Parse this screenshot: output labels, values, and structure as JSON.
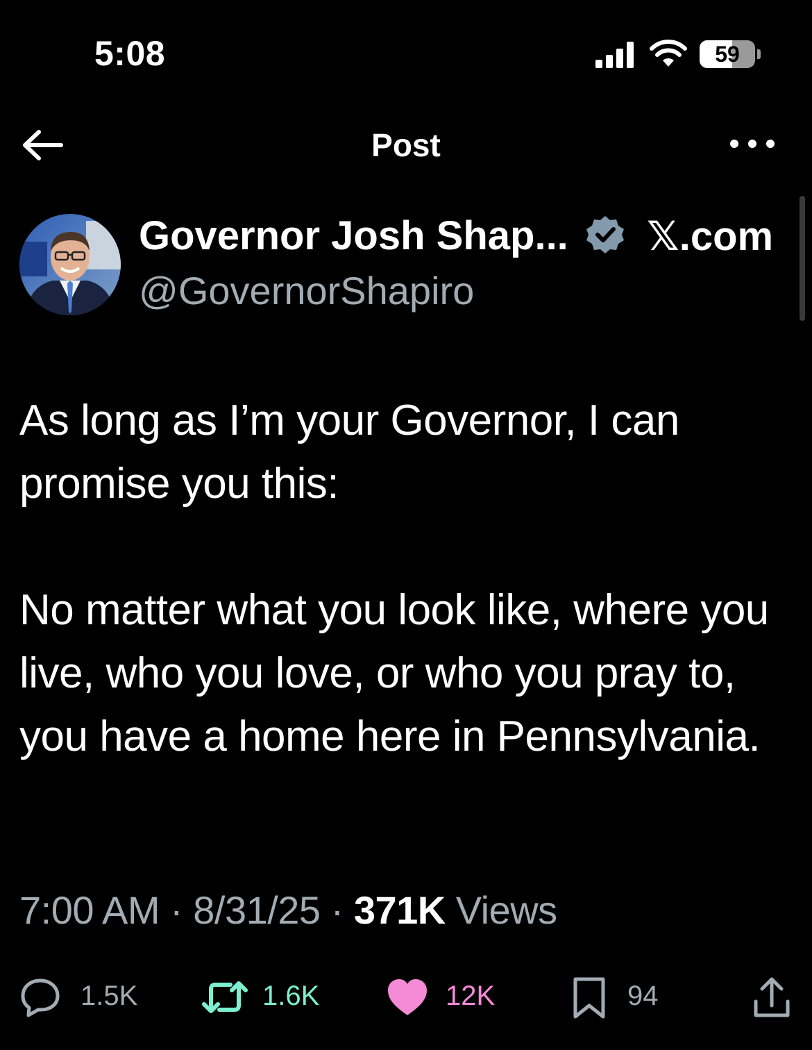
{
  "status_bar": {
    "time": "5:08",
    "battery": "59",
    "battery_level": 0.59
  },
  "nav": {
    "title": "Post"
  },
  "author": {
    "name": "Governor Josh Shap...",
    "handle": "@GovernorShapiro",
    "source_label": "𝕏.com"
  },
  "post": {
    "text": "As long as I’m your Governor, I can promise you this:\n\nNo matter what you look like, where you live, who you love, or who you pray to, you have a home here in Pennsylvania.",
    "time": "7:00 AM",
    "date": "8/31/25",
    "separator": " · ",
    "views_count": "371K",
    "views_label": " Views"
  },
  "actions": {
    "replies": "1.5K",
    "reposts": "1.6K",
    "likes": "12K",
    "bookmarks": "94"
  },
  "icons": {
    "back": "arrow-left-icon",
    "more": "ellipsis-icon",
    "verified": "verified-badge-icon",
    "reply": "reply-bubble-icon",
    "repost": "repost-icon",
    "like": "heart-icon",
    "bookmark": "bookmark-icon",
    "share": "share-icon"
  },
  "colors": {
    "background": "#000000",
    "text": "#ffffff",
    "muted": "#a3abb3",
    "verified_badge": "#829aab",
    "repost_active": "#7cf0cf",
    "like_active": "#f58ad6"
  }
}
